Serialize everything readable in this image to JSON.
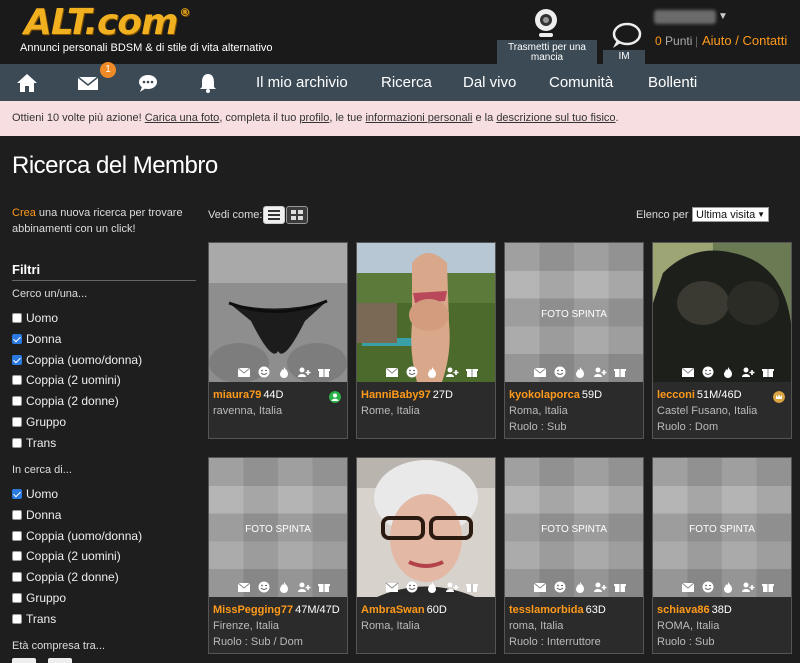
{
  "header": {
    "logo_text": "ALT.com",
    "logo_mark": "®",
    "tagline": "Annunci personali BDSM & di stile di vita alternativo",
    "tip_label": "Trasmetti per una mancia",
    "im_label": "IM",
    "points_value": "0",
    "points_label": "Punti",
    "separator": "|",
    "help_label": "Aiuto / Contatti"
  },
  "nav": {
    "notification_count": "1",
    "items": [
      "Il mio archivio",
      "Ricerca",
      "Dal vivo",
      "Comunità",
      "Bollenti"
    ]
  },
  "promo": {
    "p1": "Ottieni 10 volte più azione! ",
    "l1": "Carica una foto",
    "p2": ", completa il tuo ",
    "l2": "profilo",
    "p3": ", le tue ",
    "l3": "informazioni personali",
    "p4": " e la ",
    "l4": "descrizione sul tuo fisico",
    "p5": "."
  },
  "sidebar": {
    "title": "Ricerca del Membro",
    "crea_highlight": "Crea",
    "crea_text": " una nuova ricerca per trovare abbinamenti con un click!",
    "filters_title": "Filtri",
    "seeking_label": "Cerco un/una...",
    "seeking_options": [
      {
        "label": "Uomo",
        "checked": false
      },
      {
        "label": "Donna",
        "checked": true
      },
      {
        "label": "Coppia (uomo/donna)",
        "checked": true
      },
      {
        "label": "Coppia (2 uomini)",
        "checked": false
      },
      {
        "label": "Coppia (2 donne)",
        "checked": false
      },
      {
        "label": "Gruppo",
        "checked": false
      },
      {
        "label": "Trans",
        "checked": false
      }
    ],
    "looking_label": "In cerca di...",
    "looking_options": [
      {
        "label": "Uomo",
        "checked": true
      },
      {
        "label": "Donna",
        "checked": false
      },
      {
        "label": "Coppia (uomo/donna)",
        "checked": false
      },
      {
        "label": "Coppia (2 uomini)",
        "checked": false
      },
      {
        "label": "Coppia (2 donne)",
        "checked": false
      },
      {
        "label": "Gruppo",
        "checked": false
      },
      {
        "label": "Trans",
        "checked": false
      }
    ],
    "age_label": "Età compresa tra..."
  },
  "results": {
    "view_label": "Vedi come:",
    "sort_label": "Elenco per",
    "sort_value": "Ultima visita",
    "hidden_photo_label": "FOTO SPINTA",
    "members": [
      {
        "name": "miaura79",
        "age": "44D",
        "location": "ravenna, Italia",
        "role": "",
        "photo": "lingerie",
        "status": "online-green"
      },
      {
        "name": "HanniBaby97",
        "age": "27D",
        "location": "Rome, Italia",
        "role": "",
        "photo": "garden",
        "status": ""
      },
      {
        "name": "kyokolaporca",
        "age": "59D",
        "location": "Roma, Italia",
        "role": "Ruolo : Sub",
        "photo": "hidden",
        "status": ""
      },
      {
        "name": "lecconi",
        "age": "51M/46D",
        "location": "Castel Fusano, Italia",
        "role": "Ruolo : Dom",
        "photo": "dark",
        "status": "vip-gold"
      },
      {
        "name": "MissPegging77",
        "age": "47M/47D",
        "location": "Firenze, Italia",
        "role": "Ruolo : Sub / Dom",
        "photo": "hidden",
        "status": ""
      },
      {
        "name": "AmbraSwan",
        "age": "60D",
        "location": "Roma, Italia",
        "role": "",
        "photo": "portrait",
        "status": ""
      },
      {
        "name": "tesslamorbida",
        "age": "63D",
        "location": "roma, Italia",
        "role": "Ruolo : Interruttore",
        "photo": "hidden",
        "status": ""
      },
      {
        "name": "schiava86",
        "age": "38D",
        "location": "ROMA, Italia",
        "role": "Ruolo : Sub",
        "photo": "hidden",
        "status": ""
      }
    ]
  },
  "colors": {
    "accent": "#ff9a1a",
    "nav_bg": "#3b4a55",
    "promo_bg": "#f6dee1",
    "page_bg": "#1e1e1e"
  }
}
